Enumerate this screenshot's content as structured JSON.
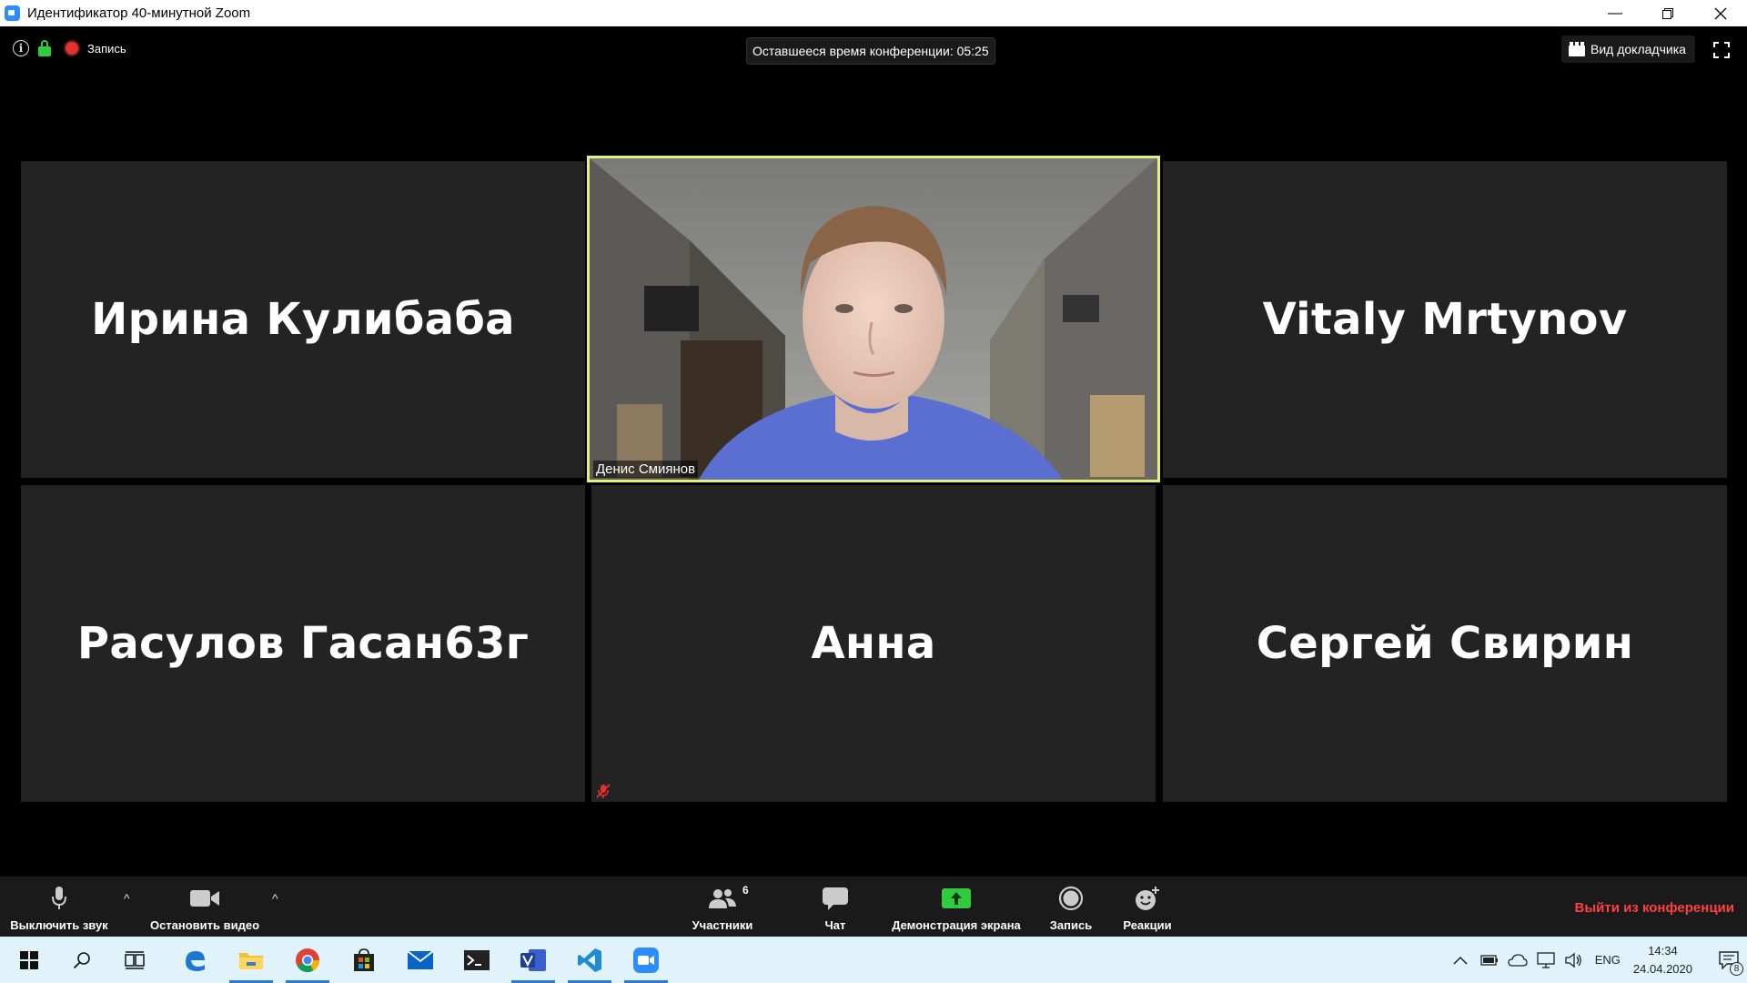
{
  "window": {
    "title": "Идентификатор 40-минутной Zoom"
  },
  "topbar": {
    "recording_label": "Запись",
    "timer_text": "Оставшееся время конференции: 05:25",
    "speaker_view_label": "Вид докладчика"
  },
  "participants": [
    {
      "name": "Ирина Кулибаба"
    },
    {
      "name": "Денис Смиянов"
    },
    {
      "name": "Vitaly Mrtynov"
    },
    {
      "name": "Расулов Гасан63г"
    },
    {
      "name": "Анна"
    },
    {
      "name": "Сергей Свирин"
    }
  ],
  "toolbar": {
    "mute_label": "Выключить звук",
    "video_label": "Остановить видео",
    "participants_label": "Участники",
    "participants_count": "6",
    "chat_label": "Чат",
    "share_label": "Демонстрация экрана",
    "record_label": "Запись",
    "reactions_label": "Реакции",
    "leave_label": "Выйти из конференции"
  },
  "taskbar": {
    "lang": "ENG",
    "time": "14:34",
    "date": "24.04.2020",
    "notifications": "8"
  },
  "colors": {
    "accent": "#2d8cff",
    "active_speaker_border": "#e9f07a",
    "leave_red": "#ff4040",
    "share_green": "#2fcc3f"
  }
}
